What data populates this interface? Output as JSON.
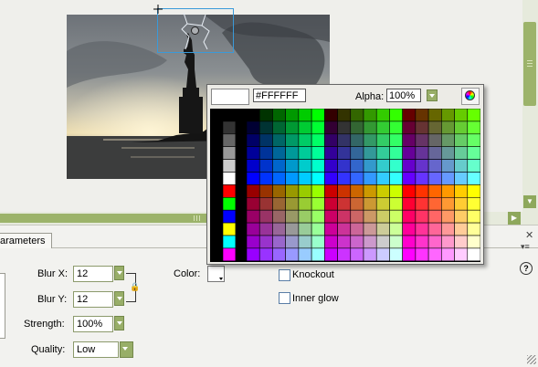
{
  "picker": {
    "hex_value": "#FFFFFF",
    "alpha_label": "Alpha:",
    "alpha_value": "100%",
    "swatch_colors": {
      "grays": [
        "#000000",
        "#333333",
        "#666666",
        "#999999",
        "#CCCCCC",
        "#FFFFFF"
      ],
      "basics": [
        "#FF0000",
        "#00FF00",
        "#0000FF",
        "#FFFF00",
        "#00FFFF",
        "#FF00FF"
      ]
    }
  },
  "panel": {
    "tab_label": "arameters",
    "blur_x_label": "Blur X:",
    "blur_x_value": "12",
    "blur_y_label": "Blur Y:",
    "blur_y_value": "12",
    "strength_label": "Strength:",
    "strength_value": "100%",
    "quality_label": "Quality:",
    "quality_value": "Low",
    "color_label": "Color:",
    "knockout_label": "Knockout",
    "inner_glow_label": "Inner glow",
    "help_glyph": "?",
    "close_glyph": "✕"
  },
  "colors": {
    "accent_green": "#98AE68",
    "selection_blue": "#3A9AD9"
  }
}
